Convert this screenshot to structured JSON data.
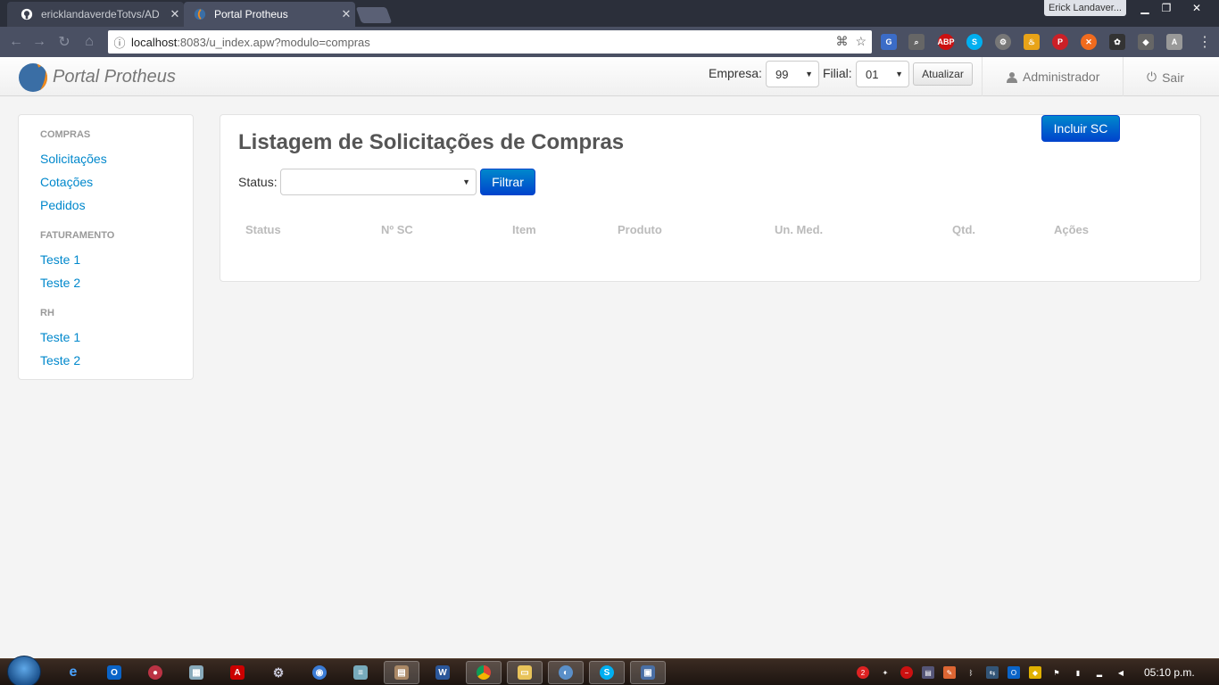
{
  "browser": {
    "tabs": [
      {
        "title": "ericklandaverdeTotvs/AD",
        "active": false
      },
      {
        "title": "Portal Protheus",
        "active": true
      }
    ],
    "profile_name": "Erick Landaver...",
    "url_host": "localhost",
    "url_rest": ":8083/u_index.apw?modulo=compras"
  },
  "app": {
    "brand": "Portal Protheus",
    "empresa_label": "Empresa:",
    "empresa_value": "99",
    "filial_label": "Filial:",
    "filial_value": "01",
    "atualizar_label": "Atualizar",
    "user_label": "Administrador",
    "logout_label": "Sair"
  },
  "sidebar": {
    "groups": [
      {
        "header": "COMPRAS",
        "items": [
          "Solicitações",
          "Cotações",
          "Pedidos"
        ]
      },
      {
        "header": "FATURAMENTO",
        "items": [
          "Teste 1",
          "Teste 2"
        ]
      },
      {
        "header": "RH",
        "items": [
          "Teste 1",
          "Teste 2"
        ]
      }
    ]
  },
  "main": {
    "title": "Listagem de Solicitações de Compras",
    "add_button": "Incluir SC",
    "status_label": "Status:",
    "status_value": "",
    "filter_button": "Filtrar",
    "columns": [
      "Status",
      "Nº SC",
      "Item",
      "Produto",
      "Un. Med.",
      "Qtd.",
      "Ações"
    ]
  },
  "taskbar": {
    "clock": "05:10 p.m.",
    "notification_count": "2"
  }
}
